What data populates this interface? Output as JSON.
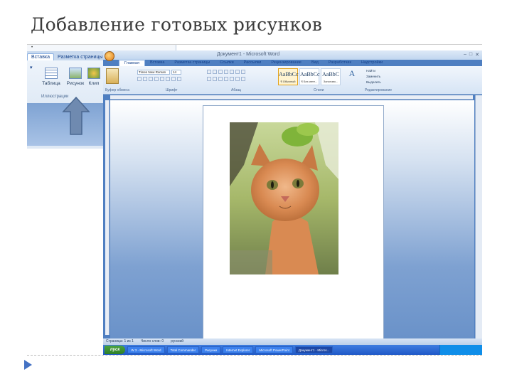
{
  "slide": {
    "title": "Добавление готовых рисунков"
  },
  "inset": {
    "tabs": [
      "Вставка",
      "Разметка страницы"
    ],
    "buttons": [
      "Таблица",
      "Рисунок",
      "Клип"
    ],
    "group_label": "Иллюстрации"
  },
  "word": {
    "window_title": "Документ1 - Microsoft Word",
    "tabs": [
      "Главная",
      "Вставка",
      "Разметка страницы",
      "Ссылки",
      "Рассылки",
      "Рецензирование",
      "Вид",
      "Разработчик",
      "Надстройки"
    ],
    "font_name": "Times New Roman",
    "font_size": "14",
    "styles": [
      {
        "sample": "AaBbCc",
        "name": "¶ Обычный"
      },
      {
        "sample": "AaBbCc",
        "name": "¶ Без инте..."
      },
      {
        "sample": "AaBbC",
        "name": "Заголово..."
      }
    ],
    "editing": [
      "Найти",
      "Заменить",
      "Выделить"
    ],
    "group_labels": {
      "clipboard": "Буфер обмена",
      "font": "Шрифт",
      "paragraph": "Абзац",
      "styles": "Стили",
      "editing": "Редактирование"
    },
    "status": {
      "page": "Страница: 1 из 1",
      "words": "Число слов: 0",
      "language": "русский"
    }
  },
  "taskbar": {
    "start": "пуск",
    "items": [
      "W 3 - Microsoft Word",
      "Total Commander",
      "Рисунки",
      "Internet Explorer",
      "Microsoft PowerPoint",
      "Документ1 - Micros..."
    ]
  }
}
